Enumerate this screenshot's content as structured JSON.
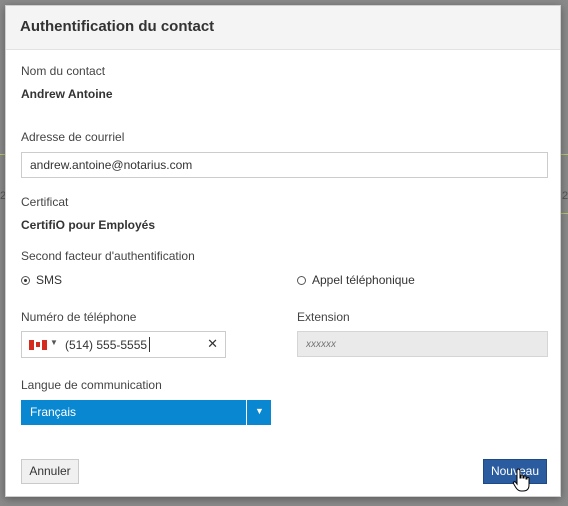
{
  "background": {
    "fragment_a": "2",
    "fragment_b": "2"
  },
  "dialog": {
    "title": "Authentification du contact",
    "contact_name_label": "Nom du contact",
    "contact_name_value": "Andrew Antoine",
    "email_label": "Adresse de courriel",
    "email_value": "andrew.antoine@notarius.com",
    "certificate_label": "Certificat",
    "certificate_value": "CertifiO pour Employés",
    "second_factor_label": "Second facteur d'authentification",
    "second_factor_options": [
      {
        "label": "SMS",
        "selected": true
      },
      {
        "label": "Appel téléphonique",
        "selected": false
      }
    ],
    "phone_label": "Numéro de téléphone",
    "phone_country": "CA",
    "phone_value": "(514) 555-5555",
    "extension_label": "Extension",
    "extension_placeholder": "xxxxxx",
    "language_label": "Langue de communication",
    "language_selected": "Français",
    "cancel_label": "Annuler",
    "new_label": "Nouveau"
  },
  "colors": {
    "select_bg": "#0a87d1",
    "primary_button": "#2a5c9f",
    "header_bg": "#f4f4f4"
  }
}
